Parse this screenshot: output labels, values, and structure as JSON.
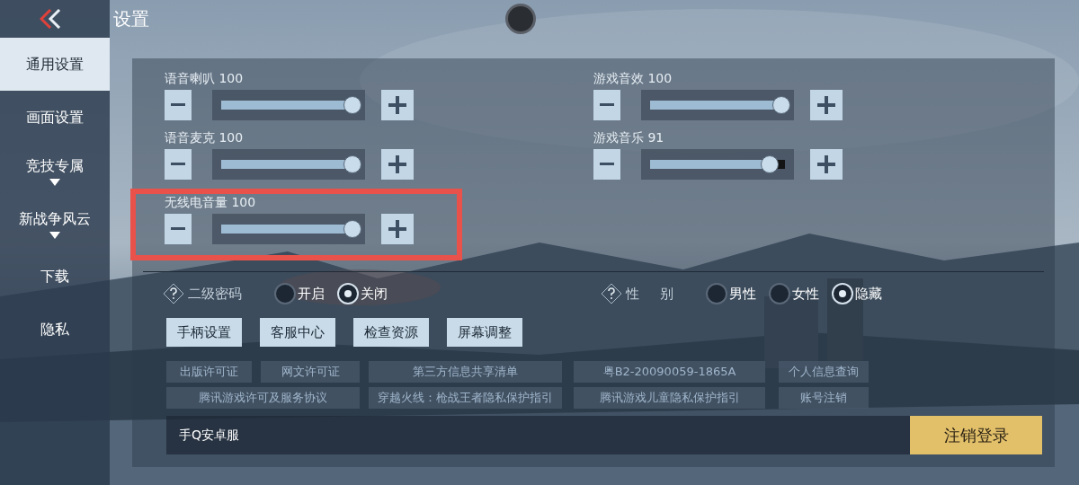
{
  "header": {
    "title": "设置"
  },
  "sidebar": {
    "items": [
      {
        "label": "通用设置",
        "selected": true,
        "expandable": false
      },
      {
        "label": "画面设置",
        "selected": false,
        "expandable": false
      },
      {
        "label": "竞技专属",
        "selected": false,
        "expandable": true
      },
      {
        "label": "新战争风云",
        "selected": false,
        "expandable": true
      },
      {
        "label": "下载",
        "selected": false,
        "expandable": false
      },
      {
        "label": "隐私",
        "selected": false,
        "expandable": false
      }
    ]
  },
  "volume": {
    "left": [
      {
        "label": "语音喇叭",
        "reading": "100",
        "level": 1,
        "highlighted": false
      },
      {
        "label": "语音麦克",
        "reading": "100",
        "level": 1,
        "highlighted": false
      },
      {
        "label": "无线电音量",
        "reading": "100",
        "level": 1,
        "highlighted": true
      }
    ],
    "right": [
      {
        "label": "游戏音效",
        "reading": "100",
        "level": 1,
        "highlighted": false
      },
      {
        "label": "游戏音乐",
        "reading": "91",
        "level": 0.91,
        "highlighted": false
      }
    ]
  },
  "options": [
    {
      "label": "二级密码",
      "choices": [
        {
          "label": "开启",
          "selected": false
        },
        {
          "label": "关闭",
          "selected": true
        }
      ]
    },
    {
      "label": "性 别",
      "choices": [
        {
          "label": "男性",
          "selected": false
        },
        {
          "label": "女性",
          "selected": false
        },
        {
          "label": "隐藏",
          "selected": true
        }
      ]
    }
  ],
  "buttons": [
    "手柄设置",
    "客服中心",
    "检查资源",
    "屏幕调整"
  ],
  "link_rows": [
    [
      "出版许可证",
      "网文许可证",
      "第三方信息共享清单",
      "粤B2-20090059-1865A",
      "个人信息查询"
    ],
    [
      "腾讯游戏许可及服务协议",
      "穿越火线：枪战王者隐私保护指引",
      "腾讯游戏儿童隐私保护指引",
      "账号注销"
    ]
  ],
  "account": {
    "server": "手Q安卓服",
    "logout_button": "注销登录"
  }
}
